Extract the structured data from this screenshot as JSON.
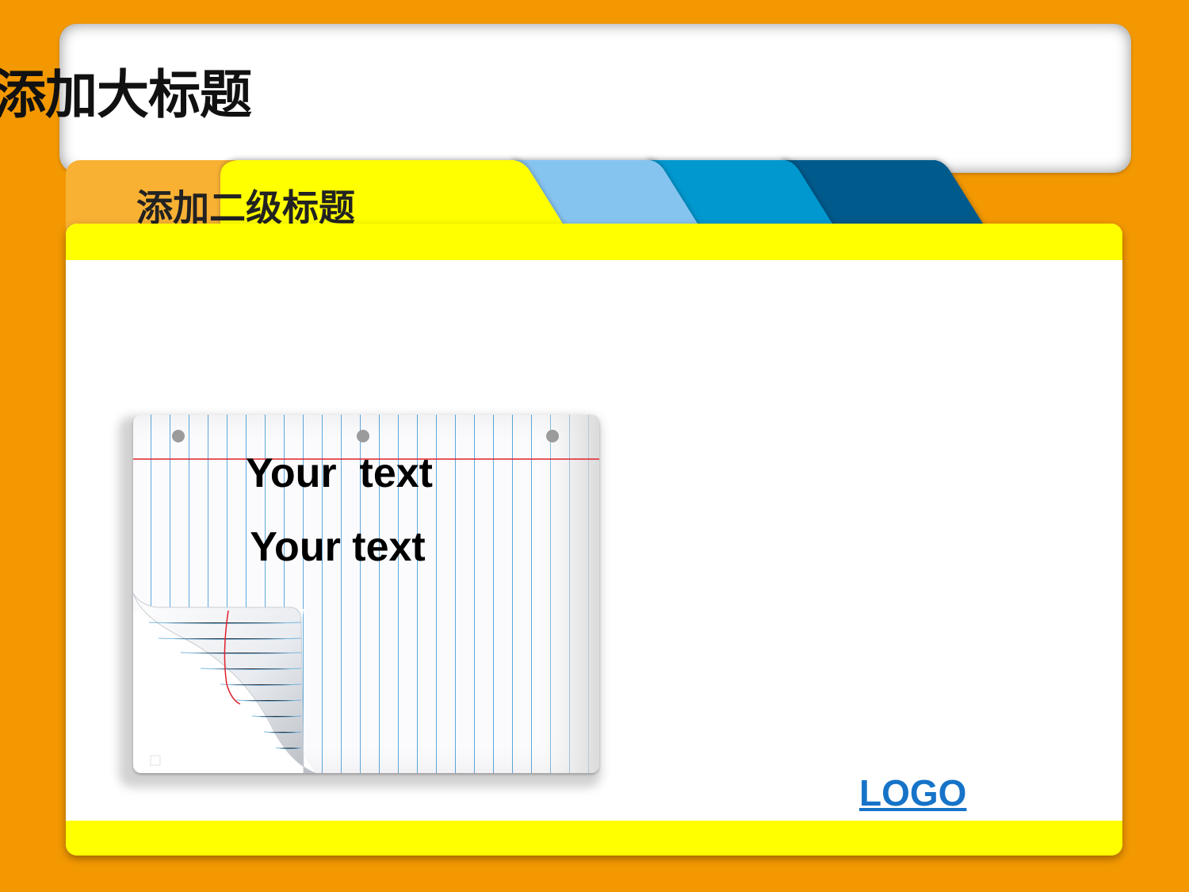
{
  "slide": {
    "main_title": "添加大标题",
    "sub_title": "添加二级标题",
    "paper_text_1": "Your  text",
    "paper_text_2": "Your text",
    "logo_text": "LOGO"
  },
  "colors": {
    "background": "#F39800",
    "panel": "#FFFFFF",
    "band_yellow": "#FFFF00",
    "tab_orange": "#F8B133",
    "stripe_light_blue": "#86C4F0",
    "stripe_mid_blue": "#0098CF",
    "stripe_dark_blue": "#005A8C",
    "logo_blue": "#1673C8",
    "paper_rule_blue": "#5DA8DC",
    "paper_margin_red": "#E0202A"
  },
  "icons": {
    "paper": "notebook-paper-page-curl"
  }
}
